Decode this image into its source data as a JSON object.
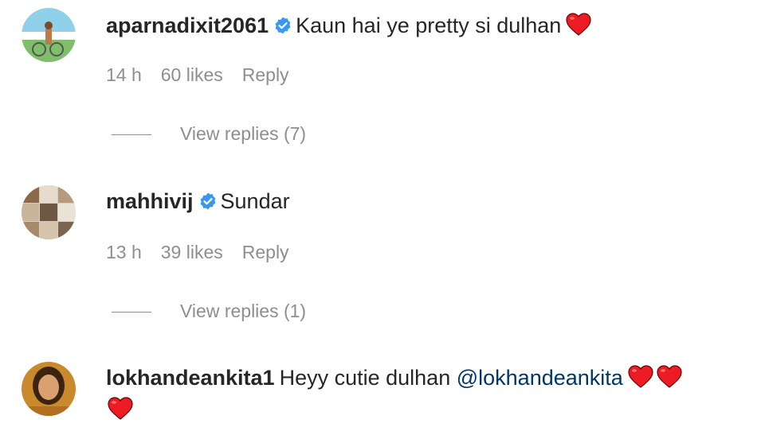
{
  "comments": [
    {
      "username": "aparnadixit2061",
      "verified": true,
      "text": "Kaun hai ye pretty si dulhan",
      "time": "14 h",
      "likes": "60 likes",
      "reply": "Reply",
      "view_replies": "View replies (7)"
    },
    {
      "username": "mahhivij",
      "verified": true,
      "text": "Sundar",
      "time": "13 h",
      "likes": "39 likes",
      "reply": "Reply",
      "view_replies": "View replies (1)"
    },
    {
      "username": "lokhandeankita1",
      "verified": false,
      "text": "Heyy cutie dulhan",
      "mention": "@lokhandeankita"
    }
  ],
  "colors": {
    "verified": "#3897f0",
    "heart": "#ed1c24",
    "meta": "#8e8e8e",
    "mention": "#00376b"
  },
  "icons": {
    "verified": "verified-badge-icon",
    "heart": "red-heart-emoji-icon"
  }
}
